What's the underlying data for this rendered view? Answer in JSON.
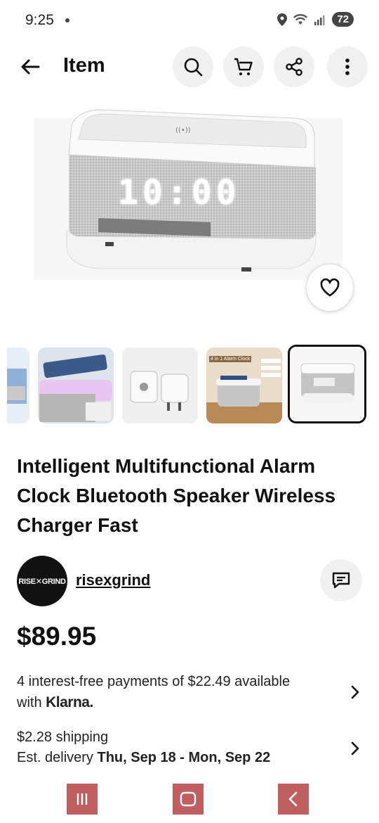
{
  "status_bar": {
    "time": "9:25",
    "battery": "72"
  },
  "header": {
    "title": "Item"
  },
  "product": {
    "title": "Intelligent Multifunctional Alarm Clock Bluetooth Speaker Wireless Charger Fast",
    "clock_display": "10:00",
    "price": "$89.95",
    "thumbnail_labels": {
      "t4_caption": "4 in 1 Alarm Clock"
    }
  },
  "seller": {
    "name": "risexgrind",
    "avatar_text": "RISE✕GRIND"
  },
  "payments": {
    "line1": "4 interest-free payments of $22.49 available",
    "line2_prefix": "with ",
    "klarna": "Klarna."
  },
  "shipping": {
    "cost": "$2.28 shipping",
    "delivery_prefix": "Est. delivery ",
    "delivery_dates": "Thu, Sep 18 - Mon, Sep 22"
  },
  "colors": {
    "nav_button": "#c05f5f",
    "icon_button_bg": "#f1f1f1"
  }
}
